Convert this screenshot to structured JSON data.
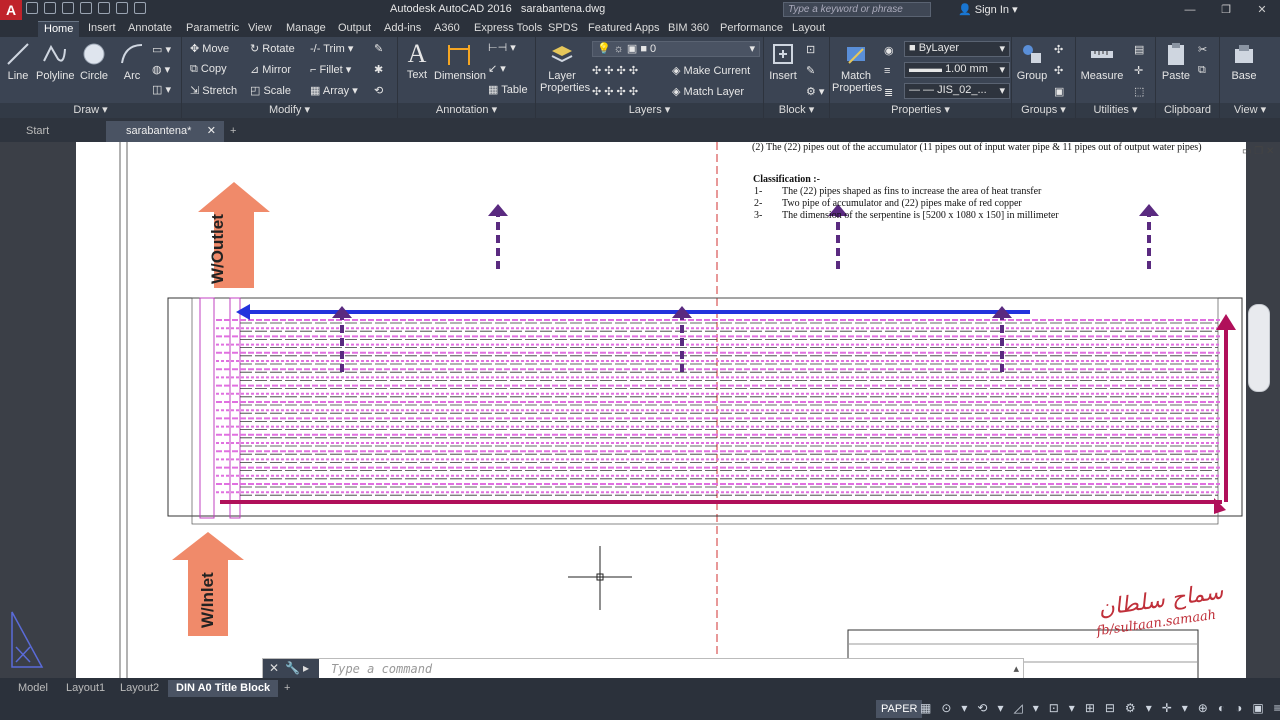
{
  "app": {
    "title": "Autodesk AutoCAD 2016",
    "filename": "sarabantena.dwg",
    "search_placeholder": "Type a keyword or phrase",
    "sign_in": "Sign In"
  },
  "ribbon_tabs": [
    "Home",
    "Insert",
    "Annotate",
    "Parametric",
    "View",
    "Manage",
    "Output",
    "Add-ins",
    "A360",
    "Express Tools",
    "SPDS",
    "Featured Apps",
    "BIM 360",
    "Performance",
    "Layout"
  ],
  "ribbon": {
    "draw": {
      "label": "Draw",
      "line": "Line",
      "polyline": "Polyline",
      "circle": "Circle",
      "arc": "Arc"
    },
    "modify": {
      "label": "Modify",
      "move": "Move",
      "rotate": "Rotate",
      "trim": "Trim",
      "copy": "Copy",
      "mirror": "Mirror",
      "fillet": "Fillet",
      "stretch": "Stretch",
      "scale": "Scale",
      "array": "Array"
    },
    "annotation": {
      "label": "Annotation",
      "text": "Text",
      "dimension": "Dimension",
      "table": "Table"
    },
    "layers": {
      "label": "Layers",
      "layer_properties": "Layer Properties",
      "current_layer": "0",
      "make_current": "Make Current",
      "match_layer": "Match Layer"
    },
    "block": {
      "label": "Block",
      "insert": "Insert"
    },
    "properties": {
      "label": "Properties",
      "match_properties": "Match Properties",
      "color": "ByLayer",
      "lineweight": "1.00 mm",
      "linetype": "JIS_02_..."
    },
    "groups": {
      "label": "Groups",
      "group": "Group"
    },
    "utilities": {
      "label": "Utilities",
      "measure": "Measure"
    },
    "clipboard": {
      "label": "Clipboard",
      "paste": "Paste"
    },
    "view": {
      "label": "View",
      "base": "Base"
    }
  },
  "doc_tabs": [
    "Start",
    "sarabantena*"
  ],
  "drawing": {
    "header_line": "(2)      The (22) pipes out of the accumulator (11 pipes out of input water pipe & 11 pipes out of output water pipes)",
    "classification_title": "Classification :-",
    "classification_items": [
      {
        "num": "1-",
        "text": "The (22) pipes shaped as fins to increase the area of heat transfer"
      },
      {
        "num": "2-",
        "text": "Two pipe of accumulator and (22) pipes make of red copper"
      },
      {
        "num": "3-",
        "text": "The dimension of the serpentine is [5200 x 1080 x 150] in millimeter"
      }
    ],
    "outlet_label": "W/Outlet",
    "inlet_label": "W/Inlet",
    "signature_arabic": "سماح سلطان",
    "signature_link": "fb/sultaan.samaah"
  },
  "command": {
    "placeholder": "Type a command"
  },
  "layout_tabs": [
    "Model",
    "Layout1",
    "Layout2",
    "DIN A0 Title Block"
  ],
  "status": {
    "space": "PAPER"
  },
  "colors": {
    "accent_red": "#c0232b",
    "ribbon_bg": "#3b4453",
    "outlet_arrow": "#f08a6a",
    "flow_blue": "#2233dd",
    "flow_magenta": "#b0105a",
    "flow_purple": "#5a2a80"
  }
}
